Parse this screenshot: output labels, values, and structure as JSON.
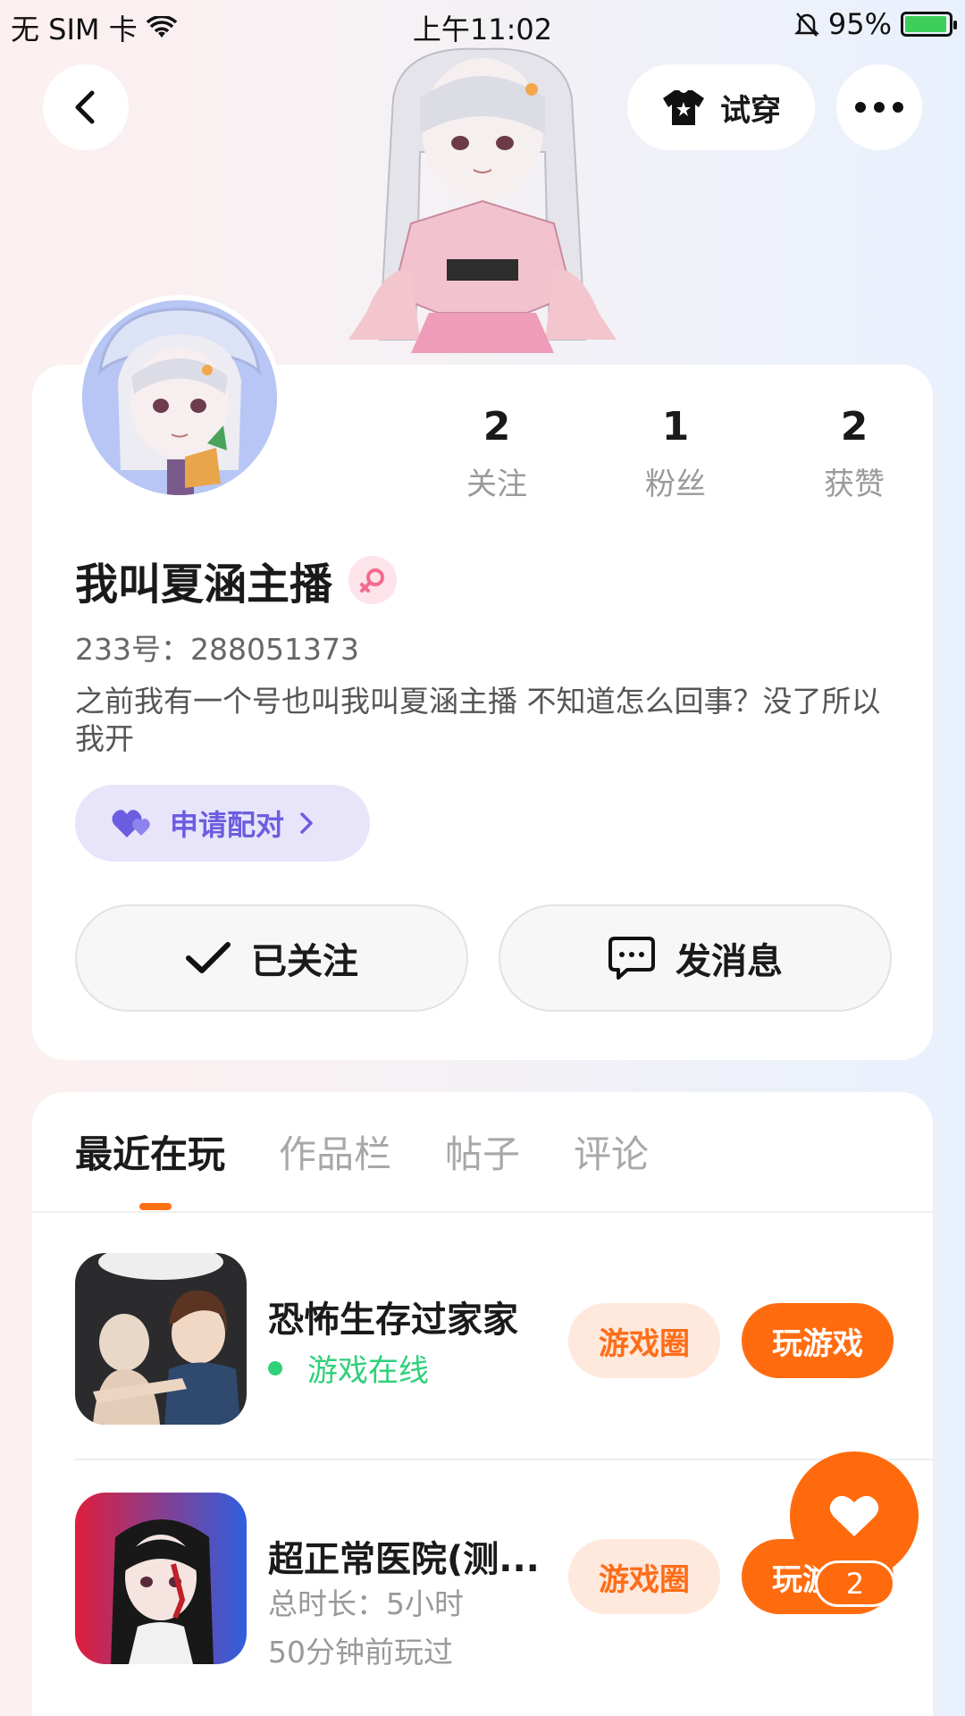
{
  "status_bar": {
    "carrier": "无 SIM 卡",
    "time": "上午11:02",
    "battery": "95%",
    "battery_level": 0.95
  },
  "header": {
    "tryon_label": "试穿"
  },
  "profile": {
    "stats": [
      {
        "num": "2",
        "label": "关注"
      },
      {
        "num": "1",
        "label": "粉丝"
      },
      {
        "num": "2",
        "label": "获赞"
      }
    ],
    "name": "我叫夏涵主播",
    "uid": "233号：288051373",
    "bio": "之前我有一个号也叫我叫夏涵主播 不知道怎么回事？没了所以我开",
    "pair_label": "申请配对",
    "follow_label": "已关注",
    "message_label": "发消息"
  },
  "tabs": [
    "最近在玩",
    "作品栏",
    "帖子",
    "评论"
  ],
  "games": [
    {
      "title": "恐怖生存过家家",
      "status": "游戏在线",
      "circle_label": "游戏圈",
      "play_label": "玩游戏"
    },
    {
      "title": "超正常医院(测...",
      "duration": "总时长：5小时",
      "last_played": "50分钟前玩过",
      "circle_label": "游戏圈",
      "play_label": "玩游戏"
    }
  ],
  "fab": {
    "count": "2"
  },
  "colors": {
    "accent": "#ff6c10",
    "online": "#2fd07a",
    "pair": "#6c5de0"
  }
}
